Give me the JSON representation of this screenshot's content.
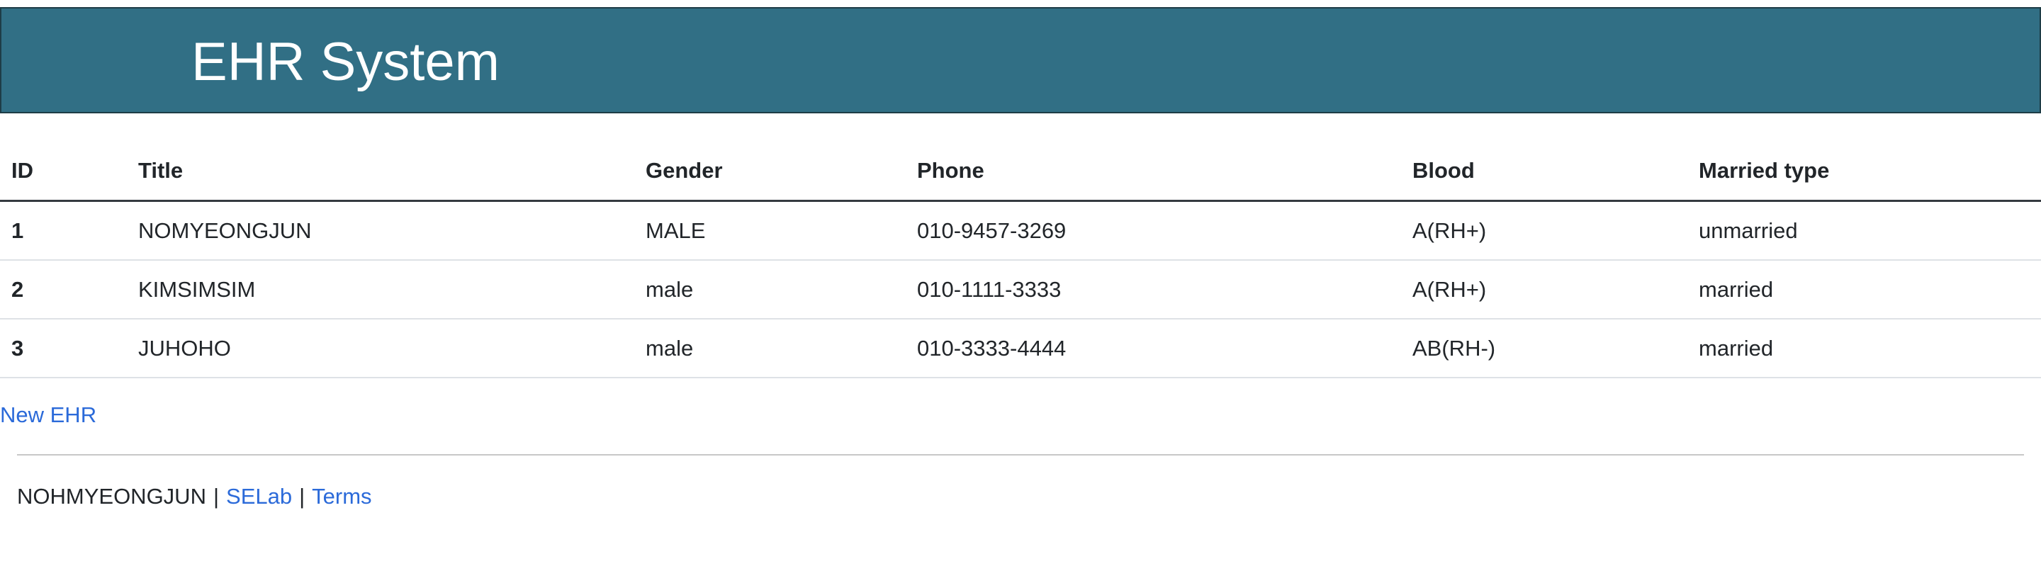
{
  "header": {
    "title": "EHR System"
  },
  "table": {
    "columns": [
      "ID",
      "Title",
      "Gender",
      "Phone",
      "Blood",
      "Married type"
    ],
    "rows": [
      [
        "1",
        "NOMYEONGJUN",
        "MALE",
        "010-9457-3269",
        "A(RH+)",
        "unmarried"
      ],
      [
        "2",
        "KIMSIMSIM",
        "male",
        "010-1111-3333",
        "A(RH+)",
        "married"
      ],
      [
        "3",
        "JUHOHO",
        "male",
        "010-3333-4444",
        "AB(RH-)",
        "married"
      ]
    ]
  },
  "actions": {
    "new_ehr_label": "New EHR"
  },
  "footer": {
    "author": "NOHMYEONGJUN",
    "separator": "|",
    "selab_label": "SELab",
    "terms_label": "Terms"
  },
  "colors": {
    "header_bg": "#316f85",
    "link": "#2b6ad9",
    "text": "#212529"
  }
}
